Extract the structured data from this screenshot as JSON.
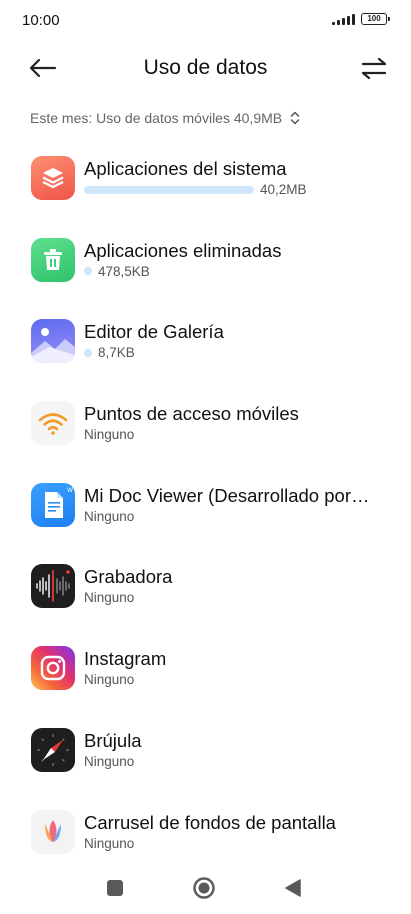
{
  "status": {
    "time": "10:00",
    "battery": "100"
  },
  "header": {
    "title": "Uso de datos",
    "back_icon": "arrow-left-icon",
    "swap_icon": "swap-arrows-icon"
  },
  "month_selector": {
    "label": "Este mes: Uso de datos móviles 40,9MB",
    "icon": "chevron-up-down-icon"
  },
  "apps": [
    {
      "name": "Aplicaciones del sistema",
      "usage": "40,2MB",
      "usage_fraction": 1.0,
      "icon": "layers-icon",
      "color": "#f06a55"
    },
    {
      "name": "Aplicaciones eliminadas",
      "usage": "478,5KB",
      "usage_fraction": 0.012,
      "icon": "trash-icon",
      "color": "#3ccf73"
    },
    {
      "name": "Editor de Galería",
      "usage": "8,7KB",
      "usage_fraction": 0.0002,
      "icon": "gallery-icon",
      "color": "#6f7ef0"
    },
    {
      "name": "Puntos de acceso móviles",
      "usage": "Ninguno",
      "icon": "wifi-hotspot-icon",
      "color": "#f39a2a"
    },
    {
      "name": "Mi Doc Viewer (Desarrollado por…",
      "usage": "Ninguno",
      "icon": "document-icon",
      "color": "#2b8ef5"
    },
    {
      "name": "Grabadora",
      "usage": "Ninguno",
      "icon": "sound-wave-icon",
      "color": "#1a1a1a"
    },
    {
      "name": "Instagram",
      "usage": "Ninguno",
      "icon": "instagram-icon",
      "color": "#e1306c"
    },
    {
      "name": "Brújula",
      "usage": "Ninguno",
      "icon": "compass-icon",
      "color": "#1a1a1a"
    },
    {
      "name": "Carrusel de fondos de pantalla",
      "usage": "Ninguno",
      "icon": "tulip-icon",
      "color": "#f07a8a"
    }
  ],
  "nav": {
    "recents_icon": "square-icon",
    "home_icon": "circle-icon",
    "back_icon": "triangle-back-icon"
  }
}
